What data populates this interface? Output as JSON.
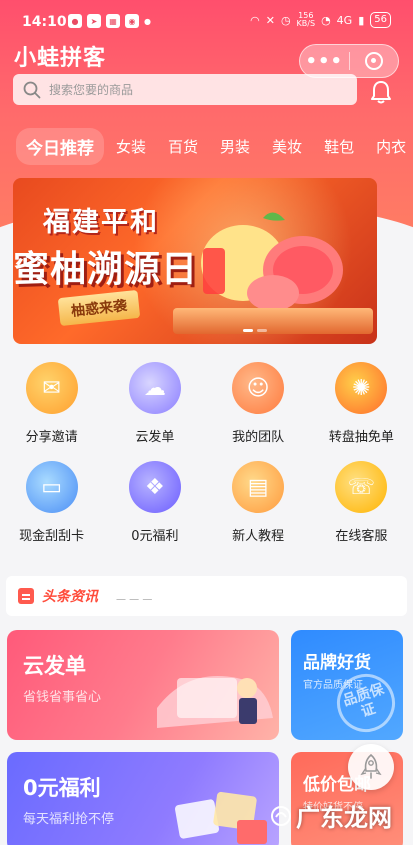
{
  "status_bar": {
    "time": "14:10",
    "speed_value": "156",
    "speed_unit": "KB/S",
    "network": "4G",
    "battery": "56"
  },
  "header": {
    "app_title": "小蛙拼客",
    "search_placeholder": "搜索您要的商品"
  },
  "tabs": [
    "今日推荐",
    "女装",
    "百货",
    "男装",
    "美妆",
    "鞋包",
    "内衣"
  ],
  "banner": {
    "line1": "福建平和",
    "line2": "蜜柚溯源日",
    "tag": "柚惑来袭"
  },
  "grid": [
    {
      "label": "分享邀请",
      "icon": "share-invite-icon"
    },
    {
      "label": "云发单",
      "icon": "cloud-order-icon"
    },
    {
      "label": "我的团队",
      "icon": "team-icon"
    },
    {
      "label": "转盘抽免单",
      "icon": "lucky-wheel-icon"
    },
    {
      "label": "现金刮刮卡",
      "icon": "scratch-card-icon"
    },
    {
      "label": "0元福利",
      "icon": "gift-icon"
    },
    {
      "label": "新人教程",
      "icon": "tutorial-icon"
    },
    {
      "label": "在线客服",
      "icon": "customer-service-icon"
    }
  ],
  "news": {
    "tag": "头条资讯"
  },
  "cards": {
    "yun": {
      "title": "云发单",
      "sub": "省钱省事省心"
    },
    "brand": {
      "title": "品牌好货",
      "sub": "官方品质保证",
      "seal": "品质保证"
    },
    "free": {
      "title": "0元福利",
      "sub": "每天福利抢不停"
    },
    "low": {
      "title": "低价包邮",
      "sub": "特价好货不停"
    }
  },
  "watermark": "广东龙网",
  "colors": {
    "header_start": "#ff4f6d",
    "header_end": "#ff7f62",
    "accent": "#ff4b3a",
    "brand_blue": "#2f8bff"
  }
}
